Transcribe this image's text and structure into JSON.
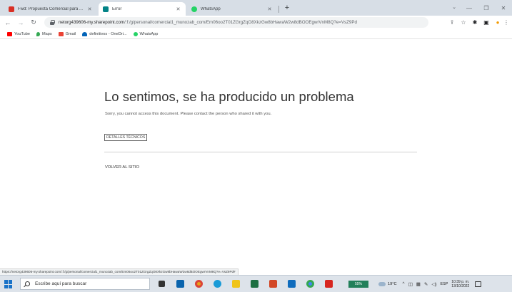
{
  "browser": {
    "tabs": [
      {
        "title": "Fwd: Propuesta Comercial para ...",
        "favicon": "gmail-icon",
        "color": "#d93025",
        "active": false
      },
      {
        "title": "Error",
        "favicon": "sharepoint-icon",
        "color": "#038387",
        "active": true
      },
      {
        "title": "WhatsApp",
        "favicon": "whatsapp-icon",
        "color": "#25d366",
        "active": false
      }
    ],
    "new_tab_label": "+",
    "url_host": "netorg439606-my.sharepoint.com",
    "url_path": "/:f:/g/personal/comercial1_munozab_com/Em06oo2T01ZGrgZqO8XkzGw8bHawaW2w8dBOOEgwrVnM8Q?e=VsZ9Pd",
    "bookmarks": [
      {
        "label": "YouTube",
        "icon": "youtube-icon",
        "color": "#ff0000"
      },
      {
        "label": "Maps",
        "icon": "maps-icon",
        "color": "#34a853"
      },
      {
        "label": "Gmail",
        "icon": "gmail-icon",
        "color": "#ea4335"
      },
      {
        "label": "definitivos - OneDri...",
        "icon": "onedrive-icon",
        "color": "#0364b8"
      },
      {
        "label": "WhatsApp",
        "icon": "whatsapp-icon",
        "color": "#25d366"
      }
    ]
  },
  "page": {
    "title": "Lo sentimos, se ha producido un problema",
    "message": "Sorry, you cannot access this document. Please contact the person who shared it with you.",
    "details_button": "DETALLES TÉCNICOS",
    "back_link": "VOLVER AL SITIO"
  },
  "status_bar": {
    "url": "https://netorg439606-my.sharepoint.com/:f:/g/personal/comercial1_munozab_com/Em06oo2T01ZGrgZqO8XkzGw8bHawaW2w8dBOOEgwrVnM8Q?e=VsZ9Pd#"
  },
  "taskbar": {
    "search_placeholder": "Escribe aquí para buscar",
    "apps": [
      {
        "name": "task-view-icon",
        "color": "#333333",
        "shape": "sq"
      },
      {
        "name": "mail-icon",
        "color": "#0a64ad",
        "shape": "sq"
      },
      {
        "name": "chrome-icon",
        "color": "#e8a317",
        "shape": "ci"
      },
      {
        "name": "edge-icon",
        "color": "#1a9bd7",
        "shape": "ci"
      },
      {
        "name": "file-explorer-icon",
        "color": "#f0c419",
        "shape": "sq"
      },
      {
        "name": "excel-icon",
        "color": "#1d6f42",
        "shape": "sq"
      },
      {
        "name": "powerpoint-icon",
        "color": "#d24726",
        "shape": "sq"
      },
      {
        "name": "outlook-icon",
        "color": "#0f6cbd",
        "shape": "sq"
      },
      {
        "name": "chrome-profile-icon",
        "color": "#4285f4",
        "shape": "ci"
      },
      {
        "name": "acrobat-icon",
        "color": "#d7261f",
        "shape": "sq"
      }
    ],
    "battery": "55%",
    "weather": "19°C",
    "language": "ESP",
    "time": "10:39 p. m.",
    "date": "13/10/2022"
  }
}
